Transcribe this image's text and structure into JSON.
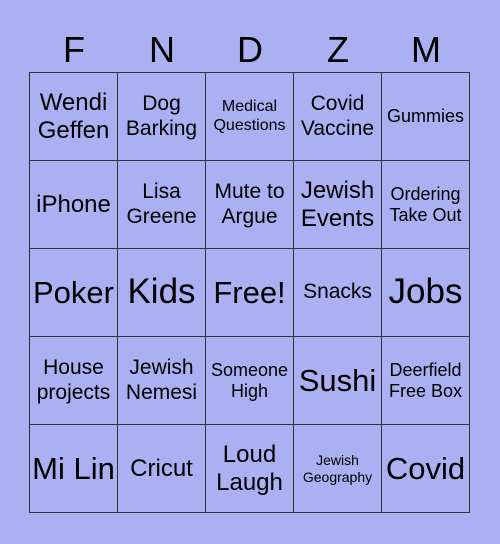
{
  "header": [
    "F",
    "N",
    "D",
    "Z",
    "M"
  ],
  "cells": [
    [
      "Wendi Geffen",
      "Dog Barking",
      "Medical Questions",
      "Covid Vaccine",
      "Gummies"
    ],
    [
      "iPhone",
      "Lisa Greene",
      "Mute to Argue",
      "Jewish Events",
      "Ordering Take Out"
    ],
    [
      "Poker",
      "Kids",
      "Free!",
      "Snacks",
      "Jobs"
    ],
    [
      "House projects",
      "Jewish Nemesi",
      "Someone High",
      "Sushi",
      "Deerfield Free Box"
    ],
    [
      "Mi Lin",
      "Cricut",
      "Loud Laugh",
      "Jewish Geography",
      "Covid"
    ]
  ],
  "colors": {
    "background": "#aab0f2",
    "grid": "#333333"
  }
}
